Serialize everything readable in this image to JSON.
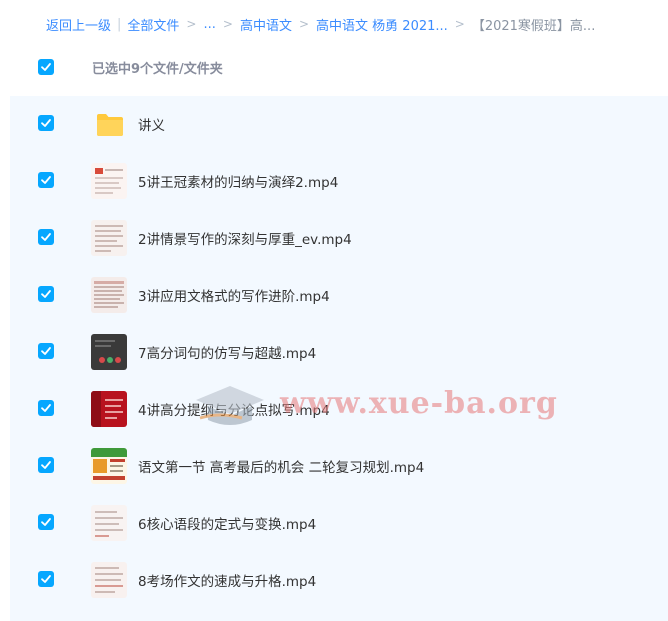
{
  "breadcrumb": {
    "back": "返回上一级",
    "all_files": "全部文件",
    "ellipsis": "...",
    "level1": "高中语文",
    "level2": "高中语文 杨勇 2021...",
    "current": "【2021寒假班】高..."
  },
  "selection": {
    "summary": "已选中9个文件/文件夹"
  },
  "items": [
    {
      "name": "讲义",
      "type": "folder"
    },
    {
      "name": "5讲王冠素材的归纳与演绎2.mp4",
      "type": "video"
    },
    {
      "name": "2讲情景写作的深刻与厚重_ev.mp4",
      "type": "video"
    },
    {
      "name": "3讲应用文格式的写作进阶.mp4",
      "type": "video"
    },
    {
      "name": "7高分词句的仿写与超越.mp4",
      "type": "video"
    },
    {
      "name": "4讲高分提纲与分论点拟写.mp4",
      "type": "video"
    },
    {
      "name": "语文第一节 高考最后的机会 二轮复习规划.mp4",
      "type": "video"
    },
    {
      "name": "6核心语段的定式与变换.mp4",
      "type": "video"
    },
    {
      "name": "8考场作文的速成与升格.mp4",
      "type": "video"
    }
  ],
  "watermark": "www.xue-ba.org",
  "colors": {
    "accent": "#06a7ff",
    "link": "#3b8cff",
    "list_bg": "#f3f9ff",
    "folder": "#ffc93c"
  }
}
